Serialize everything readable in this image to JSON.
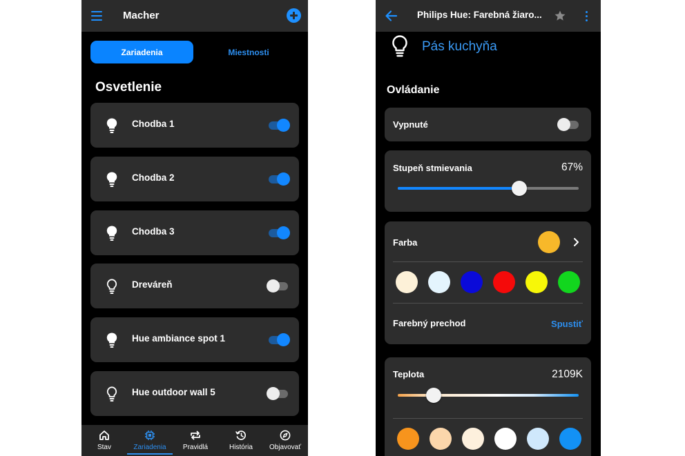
{
  "left": {
    "app_title": "Macher",
    "tabs": {
      "devices": "Zariadenia",
      "rooms": "Miestnosti"
    },
    "section_title": "Osvetlenie",
    "devices": [
      {
        "name": "Chodba 1",
        "on": true
      },
      {
        "name": "Chodba 2",
        "on": true
      },
      {
        "name": "Chodba 3",
        "on": true
      },
      {
        "name": "Dreváreň",
        "on": false
      },
      {
        "name": "Hue ambiance spot 1",
        "on": true
      },
      {
        "name": "Hue outdoor wall 5",
        "on": false
      }
    ],
    "bottom_nav": [
      {
        "label": "Stav",
        "icon": "home-icon"
      },
      {
        "label": "Zariadenia",
        "icon": "chip-icon",
        "active": true
      },
      {
        "label": "Pravidlá",
        "icon": "repeat-icon"
      },
      {
        "label": "História",
        "icon": "history-icon"
      },
      {
        "label": "Objavovať",
        "icon": "compass-icon"
      }
    ]
  },
  "right": {
    "title": "Philips Hue: Farebná žiaro...",
    "device_name": "Pás kuchyňa",
    "section_title": "Ovládanie",
    "power": {
      "label": "Vypnuté",
      "on": false
    },
    "dimming": {
      "label": "Stupeň stmievania",
      "value_text": "67%",
      "level": 0.67
    },
    "color": {
      "label": "Farba",
      "current": "#f7b82a",
      "swatches": [
        "#fdf1d8",
        "#e4f4fd",
        "#0a0ad9",
        "#f50a0a",
        "#f7f708",
        "#12d61e"
      ],
      "transition_label": "Farebný prechod",
      "transition_action": "Spustiť"
    },
    "temperature": {
      "label": "Teplota",
      "value_text": "2109K",
      "level": 0.2,
      "swatches": [
        "#f7941d",
        "#fbd6ab",
        "#fdf0dd",
        "#ffffff",
        "#cfe8fc",
        "#1391f5"
      ]
    }
  },
  "colors": {
    "accent": "#1e90ff",
    "card": "#2d2d2d",
    "topbar": "#2b2b2b"
  }
}
